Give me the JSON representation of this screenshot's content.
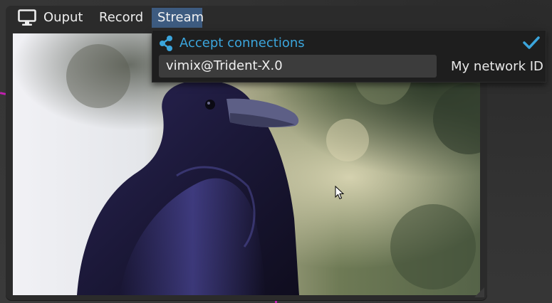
{
  "menubar": {
    "icon": "monitor-icon",
    "items": [
      {
        "label": "Ouput"
      },
      {
        "label": "Record"
      },
      {
        "label": "Stream"
      }
    ],
    "active_tab": "Stream"
  },
  "stream_panel": {
    "share_icon": "share-icon",
    "accept_label": "Accept connections",
    "accept_checked": true,
    "network_id_value": "vimix@Trident-X.0",
    "network_id_label": "My network ID"
  },
  "preview": {
    "content": "raven photograph"
  },
  "colors": {
    "active_tab": "#3d5b80",
    "accent": "#3ba5dc",
    "panel_bg": "#1e1e1e",
    "window_bg": "#2b2b2b",
    "link_line": "#c21fb0"
  }
}
